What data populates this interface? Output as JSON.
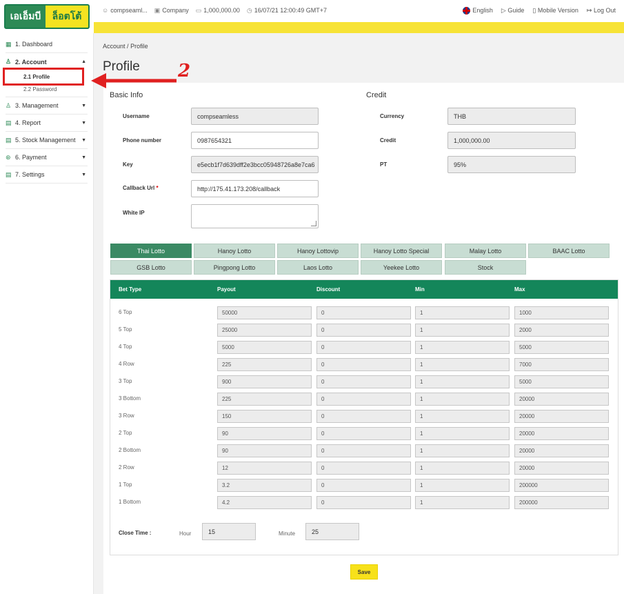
{
  "logo": {
    "part1": "เอเอ็มบี",
    "part2": "ล็อตโต้"
  },
  "topbar": {
    "user": "compseaml...",
    "company": "Company",
    "balance": "1,000,000.00",
    "datetime": "16/07/21 12:00:49 GMT+7",
    "language": "English",
    "guide": "Guide",
    "mobile": "Mobile Version",
    "logout": "Log Out"
  },
  "sidebar": {
    "items": [
      {
        "label": "1. Dashboard"
      },
      {
        "label": "2. Account"
      },
      {
        "label": "3. Management"
      },
      {
        "label": "4. Report"
      },
      {
        "label": "5. Stock Management"
      },
      {
        "label": "6. Payment"
      },
      {
        "label": "7. Settings"
      }
    ],
    "account_sub": [
      {
        "label": "2.1 Profile"
      },
      {
        "label": "2.2 Password"
      }
    ]
  },
  "annotation": {
    "step": "2"
  },
  "breadcrumb": {
    "parent": "Account",
    "sep": "/",
    "current": "Profile"
  },
  "page_title": "Profile",
  "basic_info": {
    "title": "Basic Info",
    "username_label": "Username",
    "username": "compseamless",
    "phone_label": "Phone number",
    "phone": "0987654321",
    "key_label": "Key",
    "key": "e5ecb1f7d639dff2e3bcc05948726a8e7ca6",
    "callback_label": "Callback Url",
    "callback_req": "*",
    "callback": "http://175.41.173.208/callback",
    "whiteip_label": "White IP"
  },
  "credit": {
    "title": "Credit",
    "currency_label": "Currency",
    "currency": "THB",
    "credit_label": "Credit",
    "credit": "1,000,000.00",
    "pt_label": "PT",
    "pt": "95%"
  },
  "tabs": [
    "Thai Lotto",
    "Hanoy Lotto",
    "Hanoy Lottovip",
    "Hanoy Lotto Special",
    "Malay Lotto",
    "BAAC Lotto",
    "GSB Lotto",
    "Pingpong Lotto",
    "Laos Lotto",
    "Yeekee Lotto",
    "Stock"
  ],
  "table": {
    "headers": [
      "Bet Type",
      "Payout",
      "Discount",
      "Min",
      "Max"
    ],
    "rows": [
      {
        "name": "6 Top",
        "payout": "50000",
        "discount": "0",
        "min": "1",
        "max": "1000"
      },
      {
        "name": "5 Top",
        "payout": "25000",
        "discount": "0",
        "min": "1",
        "max": "2000"
      },
      {
        "name": "4 Top",
        "payout": "5000",
        "discount": "0",
        "min": "1",
        "max": "5000"
      },
      {
        "name": "4 Row",
        "payout": "225",
        "discount": "0",
        "min": "1",
        "max": "7000"
      },
      {
        "name": "3 Top",
        "payout": "900",
        "discount": "0",
        "min": "1",
        "max": "5000"
      },
      {
        "name": "3 Bottom",
        "payout": "225",
        "discount": "0",
        "min": "1",
        "max": "20000"
      },
      {
        "name": "3 Row",
        "payout": "150",
        "discount": "0",
        "min": "1",
        "max": "20000"
      },
      {
        "name": "2 Top",
        "payout": "90",
        "discount": "0",
        "min": "1",
        "max": "20000"
      },
      {
        "name": "2 Bottom",
        "payout": "90",
        "discount": "0",
        "min": "1",
        "max": "20000"
      },
      {
        "name": "2 Row",
        "payout": "12",
        "discount": "0",
        "min": "1",
        "max": "20000"
      },
      {
        "name": "1 Top",
        "payout": "3.2",
        "discount": "0",
        "min": "1",
        "max": "200000"
      },
      {
        "name": "1 Bottom",
        "payout": "4.2",
        "discount": "0",
        "min": "1",
        "max": "200000"
      }
    ]
  },
  "close_time": {
    "label": "Close Time :",
    "hour_label": "Hour",
    "hour": "15",
    "minute_label": "Minute",
    "minute": "25"
  },
  "save_label": "Save",
  "colors": {
    "brand_green": "#14865a",
    "tab_active": "#3b8a64",
    "tab_inactive": "#c8ddd3",
    "accent_yellow": "#f7e336",
    "annotation_red": "#e02020"
  }
}
